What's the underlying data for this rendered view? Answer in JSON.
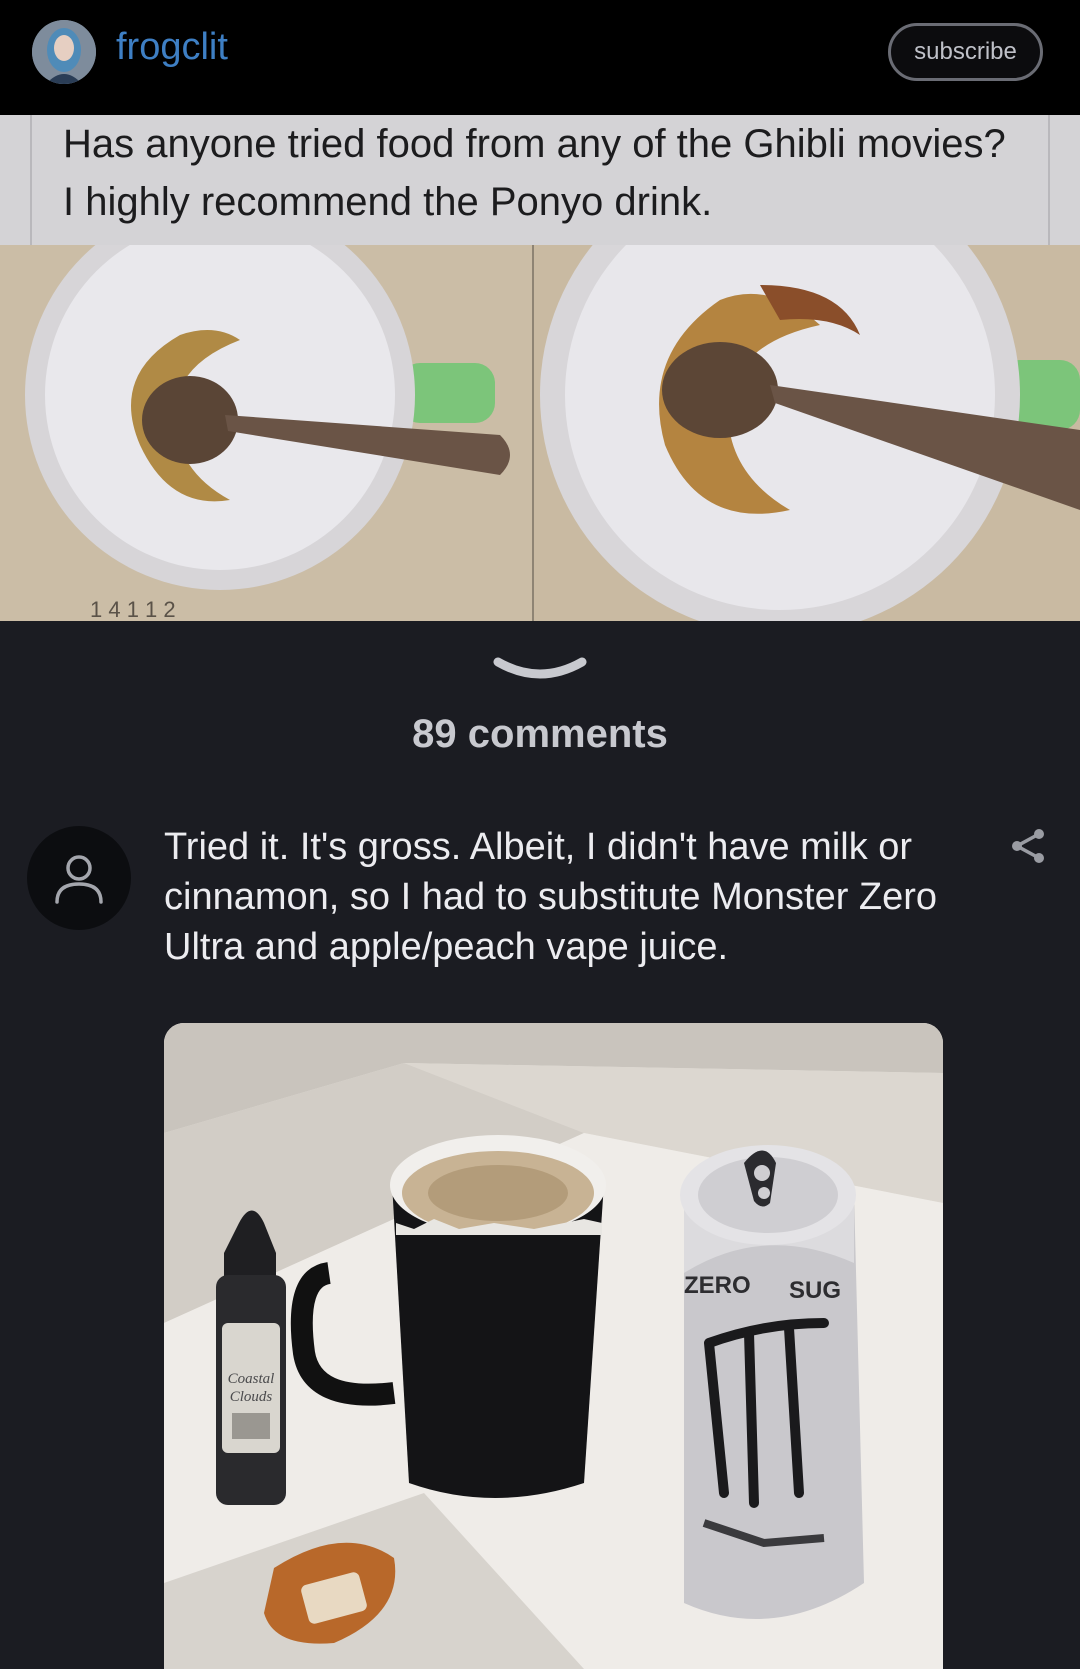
{
  "header": {
    "username": "frogclit",
    "subscribe_label": "subscribe",
    "avatar_icon": "user-avatar"
  },
  "post": {
    "caption": "Has anyone tried food from any of the Ghibli movies? I highly recommend the Ponyo drink.",
    "image_icon": "photo-two-mugs-with-spoons",
    "expand_icon": "chevron-down-icon"
  },
  "comments": {
    "count_label": "89 comments",
    "items": [
      {
        "avatar_icon": "person-icon",
        "text": "Tried it. It's gross. Albeit, I didn't have milk or cinnamon, so I had to substitute Monster Zero Ultra and apple/peach vape juice.",
        "share_icon": "share-icon",
        "image_icon": "photo-vape-juice-mug-monster-can",
        "can_text_1": "ZERO",
        "can_text_2": "SUG",
        "bottle_label": "Coastal Clouds"
      }
    ]
  },
  "colors": {
    "background": "#1b1c22",
    "username": "#3e7fc4",
    "topbar": "#000000"
  }
}
